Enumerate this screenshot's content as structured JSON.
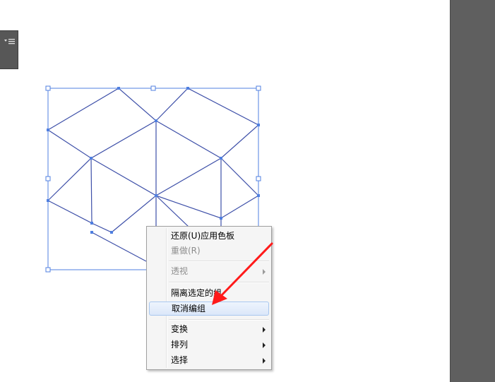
{
  "panels": {
    "mini_panel_icon": "panel-menu-icon",
    "right_panel_color": "#5f5f5f"
  },
  "artwork": {
    "stroke_color": "#3d4fa8",
    "selection_color": "#4f7fe0"
  },
  "context_menu": {
    "items": [
      {
        "label": "还原(U)应用色板",
        "enabled": true,
        "submenu": false
      },
      {
        "label": "重做(R)",
        "enabled": false,
        "submenu": false
      },
      {
        "label": "透视",
        "enabled": false,
        "submenu": true
      },
      {
        "label": "隔离选定的组",
        "enabled": true,
        "submenu": false
      },
      {
        "label": "取消编组",
        "enabled": true,
        "submenu": false,
        "highlighted": true
      },
      {
        "label": "变换",
        "enabled": true,
        "submenu": true
      },
      {
        "label": "排列",
        "enabled": true,
        "submenu": true
      },
      {
        "label": "选择",
        "enabled": true,
        "submenu": true
      }
    ]
  },
  "annotation": {
    "arrow_color": "#ff1a1a",
    "points_to": "取消编组"
  }
}
